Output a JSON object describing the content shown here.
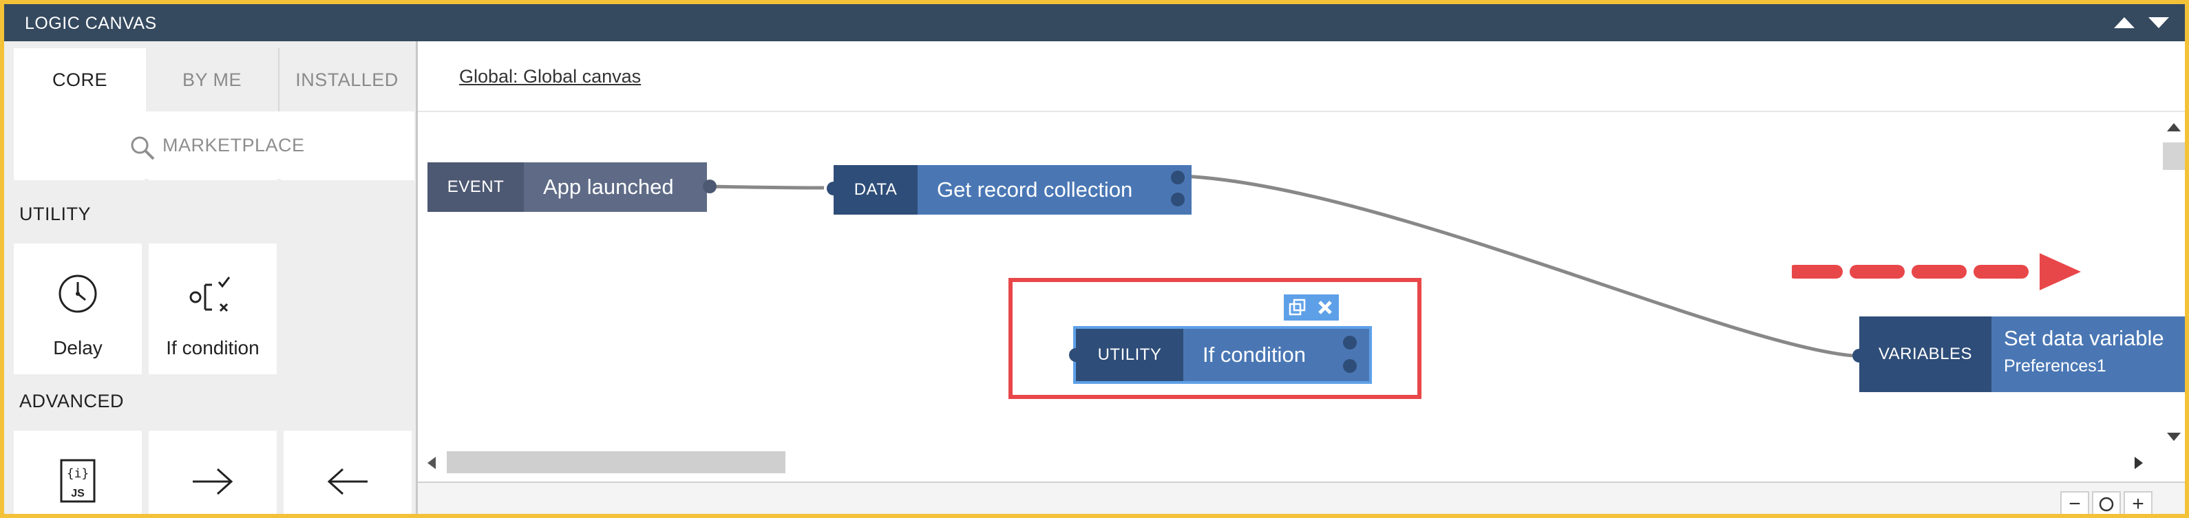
{
  "window": {
    "title": "LOGIC CANVAS"
  },
  "sidebar": {
    "tabs": [
      "CORE",
      "BY ME",
      "INSTALLED"
    ],
    "marketplace_label": "MARKETPLACE",
    "sections": [
      {
        "title": "UTILITY",
        "items": [
          "Delay",
          "If condition"
        ]
      },
      {
        "title": "ADVANCED",
        "items": [
          "",
          "",
          ""
        ]
      }
    ]
  },
  "canvas": {
    "breadcrumb": "Global: Global canvas",
    "nodes": {
      "event": {
        "kind": "EVENT",
        "name": "App launched"
      },
      "data": {
        "kind": "DATA",
        "name": "Get record collection"
      },
      "utility": {
        "kind": "UTILITY",
        "name": "If condition"
      },
      "variables": {
        "kind": "VARIABLES",
        "name": "Set data variable",
        "subtitle": "Preferences1"
      }
    },
    "zoom_controls": [
      "−",
      "+"
    ]
  },
  "colors": {
    "titlebar": "#354a5f",
    "node_dark": "#2e4d78",
    "node_light": "#4a77b4",
    "event_dark": "#4d5872",
    "event_light": "#5f6b86",
    "highlight": "#e8474a",
    "selection": "#5ea0e8"
  }
}
